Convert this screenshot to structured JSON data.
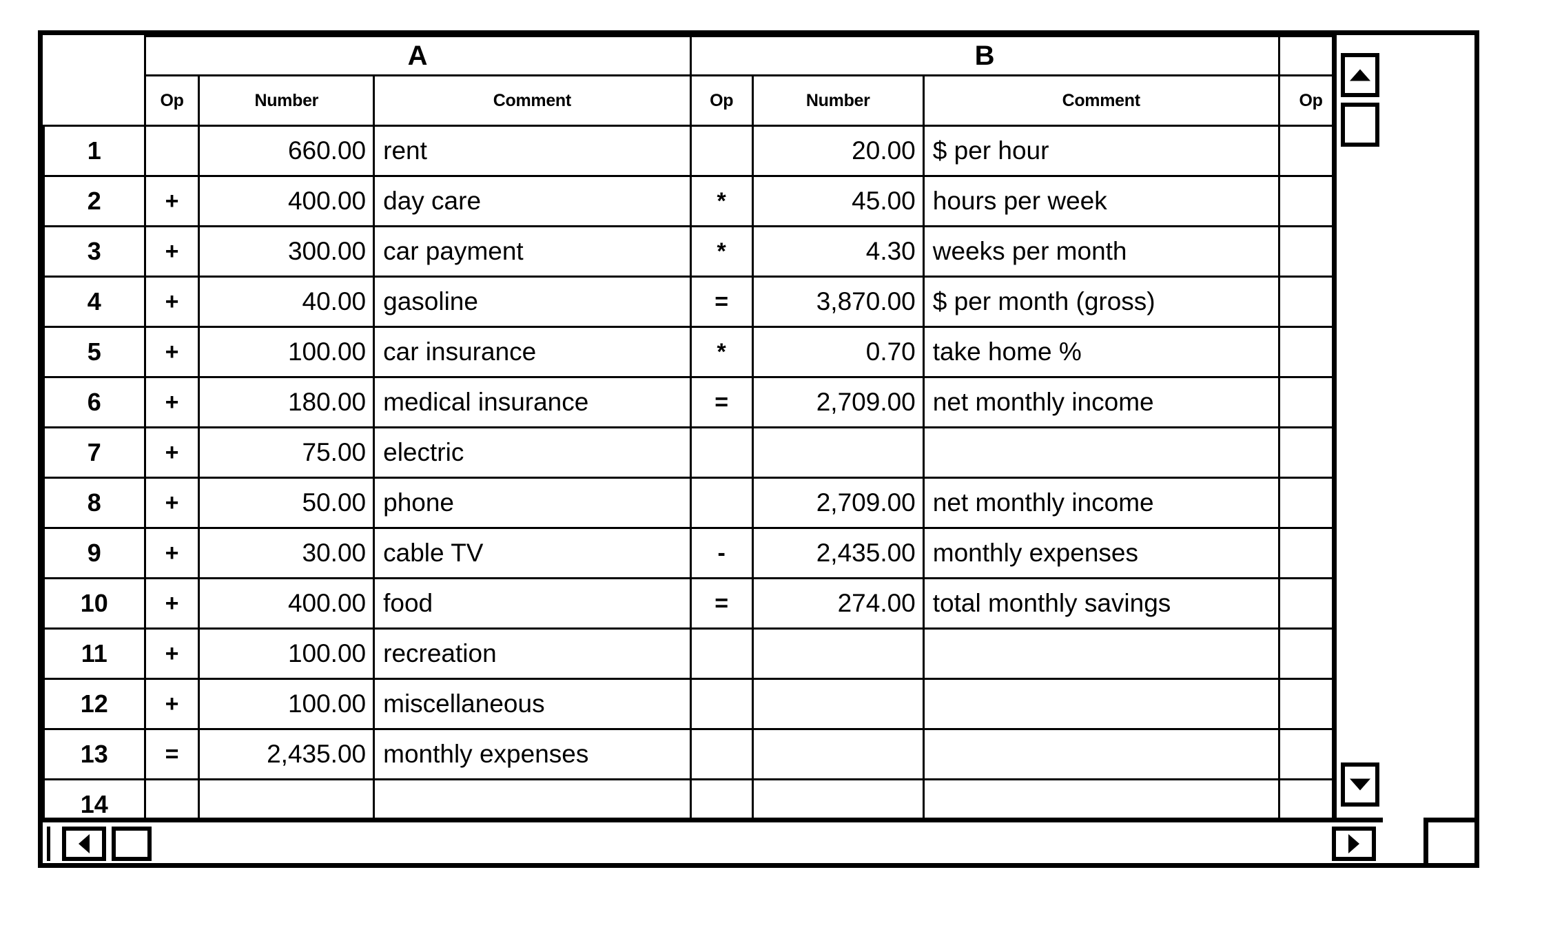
{
  "window": {
    "kind": "spreadsheet-window"
  },
  "groups": {
    "a_label": "A",
    "b_label": "B"
  },
  "subheaders": {
    "op": "Op",
    "number": "Number",
    "comment": "Comment",
    "trailing_op": "Op"
  },
  "scrollbars": {
    "up_arrow": "scroll-up-arrow",
    "down_arrow": "scroll-down-arrow",
    "left_arrow": "scroll-left-arrow",
    "right_arrow": "scroll-right-arrow"
  },
  "rows": [
    {
      "n": "1",
      "a_op": "",
      "a_num": "660.00",
      "a_com": "rent",
      "b_op": "",
      "b_num": "20.00",
      "b_com": "$ per hour",
      "c_op": ""
    },
    {
      "n": "2",
      "a_op": "+",
      "a_num": "400.00",
      "a_com": "day care",
      "b_op": "*",
      "b_num": "45.00",
      "b_com": "hours per week",
      "c_op": ""
    },
    {
      "n": "3",
      "a_op": "+",
      "a_num": "300.00",
      "a_com": "car payment",
      "b_op": "*",
      "b_num": "4.30",
      "b_com": "weeks per month",
      "c_op": ""
    },
    {
      "n": "4",
      "a_op": "+",
      "a_num": "40.00",
      "a_com": "gasoline",
      "b_op": "=",
      "b_num": "3,870.00",
      "b_com": "$ per month (gross)",
      "c_op": ""
    },
    {
      "n": "5",
      "a_op": "+",
      "a_num": "100.00",
      "a_com": "car insurance",
      "b_op": "*",
      "b_num": "0.70",
      "b_com": "take home %",
      "c_op": ""
    },
    {
      "n": "6",
      "a_op": "+",
      "a_num": "180.00",
      "a_com": "medical insurance",
      "b_op": "=",
      "b_num": "2,709.00",
      "b_com": "net monthly income",
      "c_op": ""
    },
    {
      "n": "7",
      "a_op": "+",
      "a_num": "75.00",
      "a_com": "electric",
      "b_op": "",
      "b_num": "",
      "b_com": "",
      "c_op": ""
    },
    {
      "n": "8",
      "a_op": "+",
      "a_num": "50.00",
      "a_com": "phone",
      "b_op": "",
      "b_num": "2,709.00",
      "b_com": "net monthly income",
      "c_op": ""
    },
    {
      "n": "9",
      "a_op": "+",
      "a_num": "30.00",
      "a_com": "cable TV",
      "b_op": "-",
      "b_num": "2,435.00",
      "b_com": "monthly expenses",
      "c_op": ""
    },
    {
      "n": "10",
      "a_op": "+",
      "a_num": "400.00",
      "a_com": "food",
      "b_op": "=",
      "b_num": "274.00",
      "b_com": "total monthly savings",
      "c_op": ""
    },
    {
      "n": "11",
      "a_op": "+",
      "a_num": "100.00",
      "a_com": "recreation",
      "b_op": "",
      "b_num": "",
      "b_com": "",
      "c_op": ""
    },
    {
      "n": "12",
      "a_op": "+",
      "a_num": "100.00",
      "a_com": "miscellaneous",
      "b_op": "",
      "b_num": "",
      "b_com": "",
      "c_op": ""
    },
    {
      "n": "13",
      "a_op": "=",
      "a_num": "2,435.00",
      "a_com": "monthly expenses",
      "b_op": "",
      "b_num": "",
      "b_com": "",
      "c_op": ""
    },
    {
      "n": "14",
      "a_op": "",
      "a_num": "",
      "a_com": "",
      "b_op": "",
      "b_num": "",
      "b_com": "",
      "c_op": ""
    }
  ]
}
